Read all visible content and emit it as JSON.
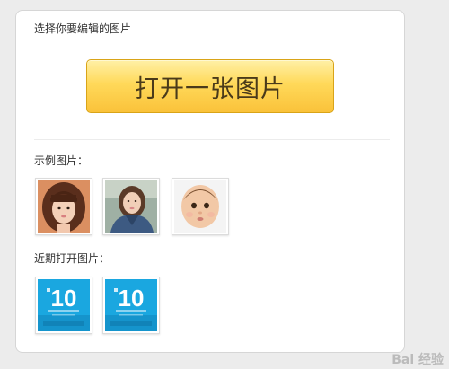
{
  "header": {
    "title": "选择你要编辑的图片"
  },
  "open_button": {
    "label": "打开一张图片"
  },
  "examples": {
    "label": "示例图片：",
    "items": [
      {
        "name": "example-photo-woman-bangs"
      },
      {
        "name": "example-photo-woman-denim"
      },
      {
        "name": "example-photo-baby"
      }
    ]
  },
  "recent": {
    "label": "近期打开图片：",
    "items": [
      {
        "name": "recent-photo-windows-10"
      },
      {
        "name": "recent-photo-windows-10"
      }
    ]
  },
  "watermark": {
    "text": "Bai 经验"
  },
  "colors": {
    "button_top": "#fff0a6",
    "button_bottom": "#fac23a",
    "button_border": "#d9a418",
    "thumb_blue": "#1aa7e0"
  }
}
